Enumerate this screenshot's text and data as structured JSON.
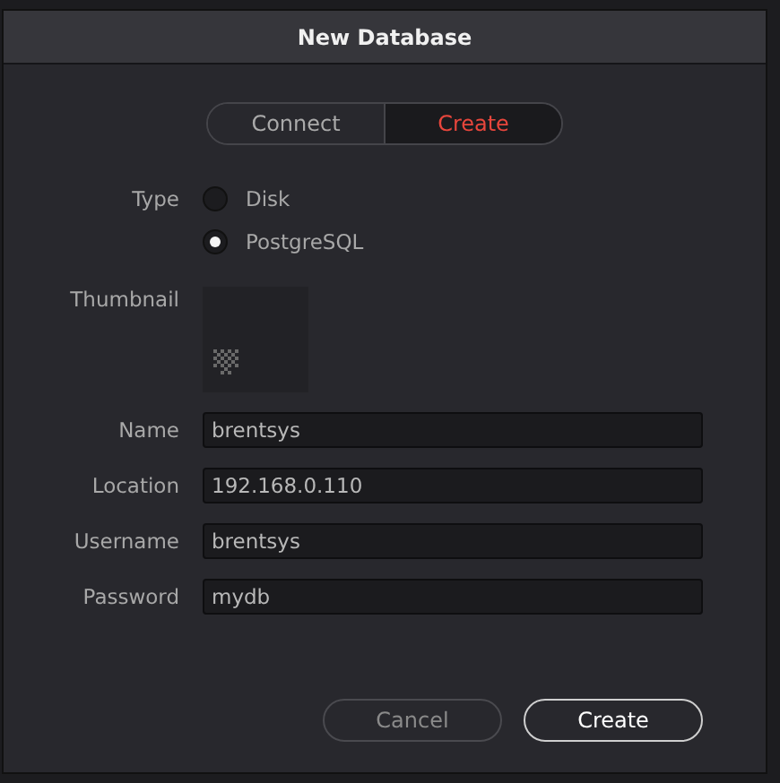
{
  "window": {
    "title": "New Database"
  },
  "mode_tabs": [
    {
      "label": "Connect",
      "selected": false
    },
    {
      "label": "Create",
      "selected": true
    }
  ],
  "type": {
    "label": "Type",
    "options": [
      {
        "label": "Disk",
        "selected": false
      },
      {
        "label": "PostgreSQL",
        "selected": true
      }
    ]
  },
  "thumbnail": {
    "label": "Thumbnail"
  },
  "fields": [
    {
      "label": "Name",
      "value": "brentsys"
    },
    {
      "label": "Location",
      "value": "192.168.0.110"
    },
    {
      "label": "Username",
      "value": "brentsys"
    },
    {
      "label": "Password",
      "value": "mydb"
    }
  ],
  "buttons": [
    {
      "label": "Cancel",
      "kind": "secondary"
    },
    {
      "label": "Create",
      "kind": "primary"
    }
  ]
}
